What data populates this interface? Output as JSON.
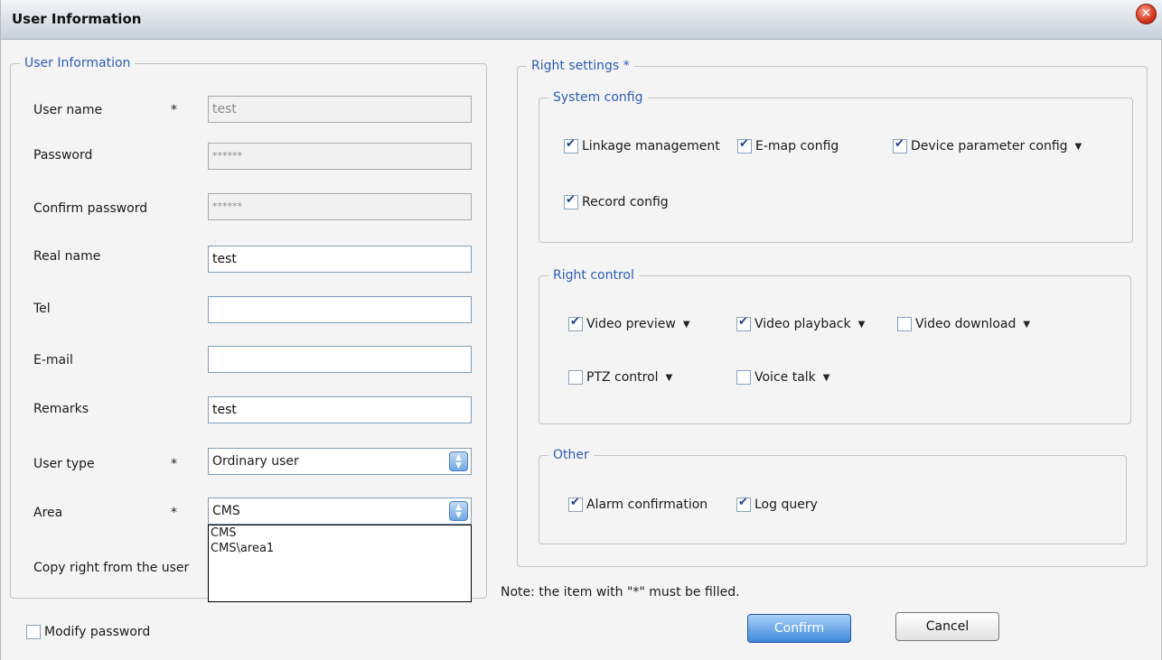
{
  "window": {
    "title": "User Information"
  },
  "user_info": {
    "legend": "User Information",
    "fields": [
      {
        "label": "User name",
        "required": "*",
        "value": "test",
        "disabled": true
      },
      {
        "label": "Password",
        "required": "",
        "value": "******",
        "disabled": true
      },
      {
        "label": "Confirm password",
        "required": "",
        "value": "******",
        "disabled": true
      },
      {
        "label": "Real name",
        "required": "",
        "value": "test",
        "disabled": false
      },
      {
        "label": "Tel",
        "required": "",
        "value": "",
        "disabled": false
      },
      {
        "label": "E-mail",
        "required": "",
        "value": "",
        "disabled": false
      },
      {
        "label": "Remarks",
        "required": "",
        "value": "test",
        "disabled": false
      }
    ],
    "user_type": {
      "label": "User type",
      "required": "*",
      "value": "Ordinary user"
    },
    "area": {
      "label": "Area",
      "required": "*",
      "value": "CMS",
      "options": [
        "CMS",
        "CMS\\area1"
      ]
    },
    "copy_right": {
      "label": "Copy right from the user"
    }
  },
  "modify_password": {
    "label": "Modify password",
    "checked": false
  },
  "right_settings": {
    "legend": "Right settings *",
    "system_config": {
      "legend": "System config",
      "items": [
        {
          "label": "Linkage management",
          "checked": true,
          "dropdown": false
        },
        {
          "label": "E-map config",
          "checked": true,
          "dropdown": false
        },
        {
          "label": "Device parameter config",
          "checked": true,
          "dropdown": true
        },
        {
          "label": "Record config",
          "checked": true,
          "dropdown": false
        }
      ]
    },
    "right_control": {
      "legend": "Right control",
      "items": [
        {
          "label": "Video preview",
          "checked": true,
          "dropdown": true
        },
        {
          "label": "Video playback",
          "checked": true,
          "dropdown": true
        },
        {
          "label": "Video download",
          "checked": false,
          "dropdown": true
        },
        {
          "label": "PTZ control",
          "checked": false,
          "dropdown": true
        },
        {
          "label": "Voice talk",
          "checked": false,
          "dropdown": true
        }
      ]
    },
    "other": {
      "legend": "Other",
      "items": [
        {
          "label": "Alarm confirmation",
          "checked": true,
          "dropdown": false
        },
        {
          "label": "Log query",
          "checked": true,
          "dropdown": false
        }
      ]
    }
  },
  "note": "Note: the item with \"*\"  must be filled.",
  "buttons": {
    "confirm": "Confirm",
    "cancel": "Cancel"
  },
  "icons": {
    "dropdown_arrow": "triangle-down-icon",
    "select_arrow": "updown-spinner-icon",
    "close": "close-icon"
  }
}
